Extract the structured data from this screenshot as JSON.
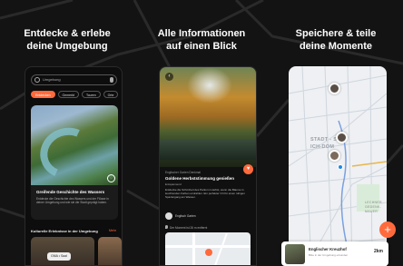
{
  "headlines": [
    "Entdecke & erlebe\ndeine Umgebung",
    "Alle Informationen\nauf einen Blick",
    "Speichere & teile\ndeine Momente"
  ],
  "screen1": {
    "search_placeholder": "Umgebung",
    "chips": [
      "Entdecken",
      "Gemerkt",
      "Touren",
      "Orte"
    ],
    "card_title": "Greifende Geschichte des Wassers",
    "card_text": "Entdecke die Geschichte des Wassers und der Flüsse in deiner Umgebung und wie sie die Stadt geprägt haben.",
    "section_title": "Kulturelle Erlebnisse in der Umgebung",
    "section_more": "Mehr",
    "control_label": "GMA • Saal"
  },
  "screen2": {
    "back_icon": "‹",
    "heart_icon": "♥",
    "category": "Englischer Garten Denkmal",
    "title": "Goldene Herbststimmung genießen",
    "subtitle": "Entspannend",
    "text": "Entdecke die Schönheit des Parks im Herbst, wenn die Bäume in leuchtenden Farben erstrahlen. Ein perfekter Ort für einen ruhigen Spaziergang am Wasser.",
    "author": "Englisch Garten",
    "note": "Der Moment ist 26 m entfernt"
  },
  "screen3": {
    "map_labels": [
      "STADT - ST.",
      "ICH-DOM"
    ],
    "small_labels": [
      "LECHNER",
      "GEDENK-",
      "MAUER"
    ],
    "fab_label": "+",
    "card_title": "Englischer Kreuzhof",
    "card_sub": "Bitte in der Umgebung erkunden",
    "card_dist": "2km"
  },
  "colors": {
    "accent": "#ff6a3d",
    "background": "#131313"
  }
}
